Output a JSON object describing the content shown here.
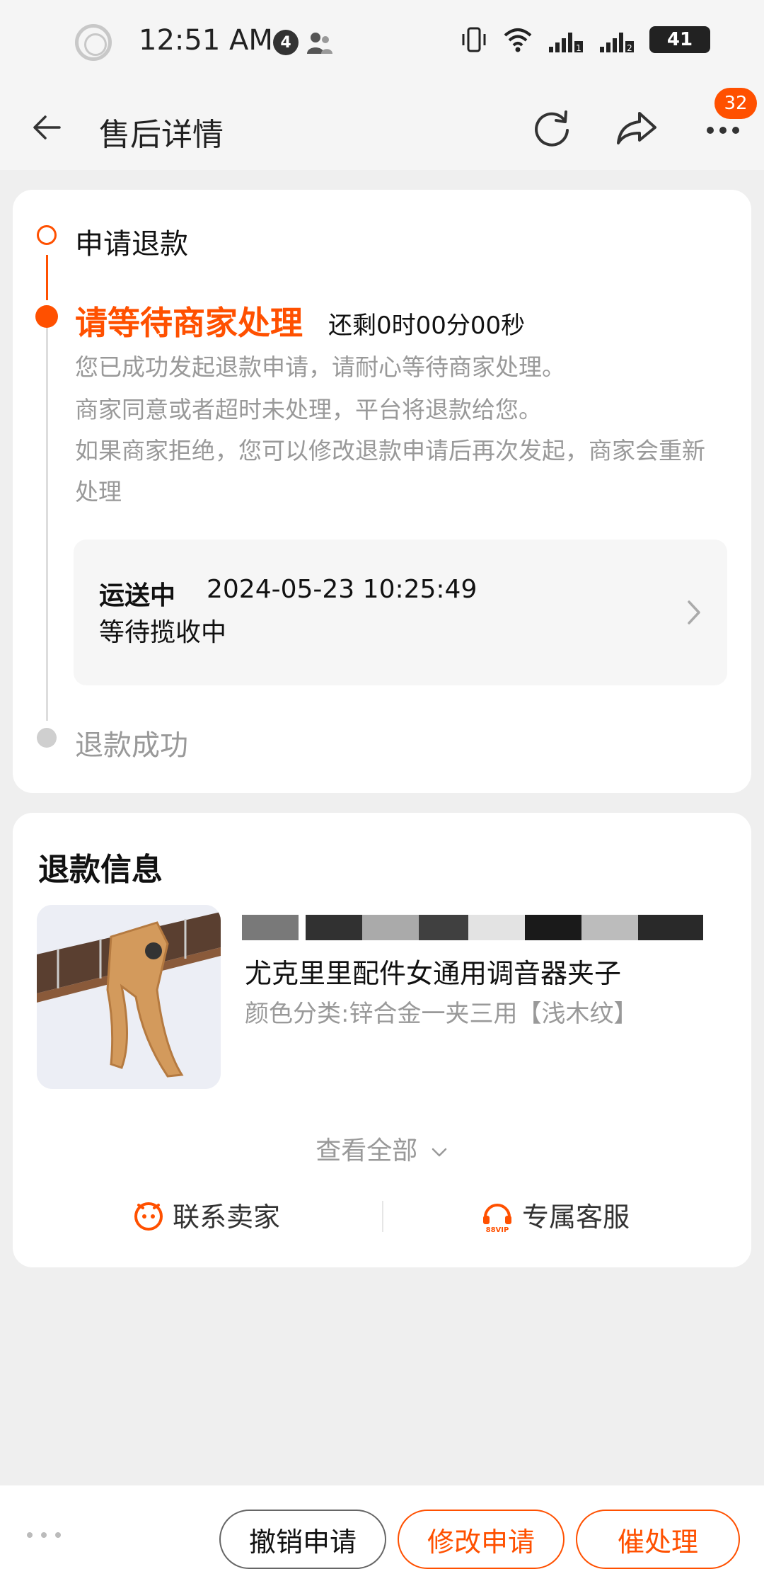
{
  "status_bar": {
    "time": "12:51 AM",
    "notification_count": "4",
    "battery": "41",
    "icons": [
      "record-icon",
      "person-icon",
      "vibrate-icon",
      "wifi-icon",
      "signal-1-icon",
      "signal-2-icon",
      "battery-icon"
    ]
  },
  "nav": {
    "title": "售后详情",
    "more_badge": "32",
    "icons": [
      "back-arrow-icon",
      "refresh-icon",
      "share-icon",
      "more-icon"
    ]
  },
  "progress": {
    "step1_label": "申请退款",
    "step2_title": "请等待商家处理",
    "step2_countdown": "还剩0时00分00秒",
    "desc1": "您已成功发起退款申请，请耐心等待商家处理。",
    "desc2": "商家同意或者超时未处理，平台将退款给您。",
    "desc3": "如果商家拒绝，您可以修改退款申请后再次发起，商家会重新处理",
    "shipping": {
      "status": "运送中",
      "time": "2024-05-23 10:25:49",
      "detail": "等待揽收中"
    },
    "step3_label": "退款成功",
    "accent_color": "#ff5000"
  },
  "refund_info": {
    "title": "退款信息",
    "product_name": "尤克里里配件女通用调音器夹子",
    "product_sku": "颜色分类:锌合金一夹三用【浅木纹】",
    "view_all": "查看全部",
    "contact_seller": "联系卖家",
    "exclusive_service": "专属客服",
    "vip_label": "88VIP"
  },
  "bottom_bar": {
    "cancel_label": "撤销申请",
    "modify_label": "修改申请",
    "urge_label": "催处理"
  }
}
